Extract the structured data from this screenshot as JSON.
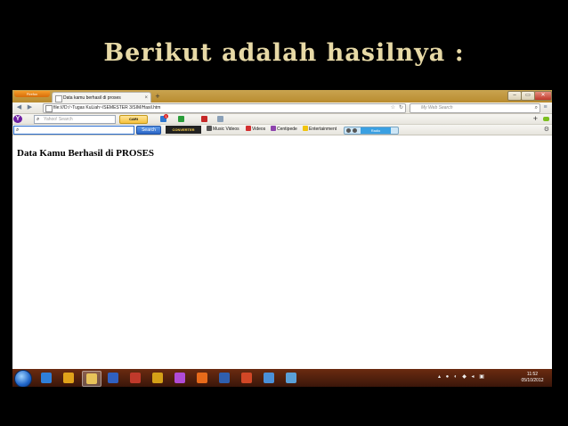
{
  "slide": {
    "title": "Berikut adalah hasilnya :"
  },
  "browser": {
    "menu_button": "Firefox",
    "tab_title": "Data kamu berhasil di proses",
    "tab_close": "×",
    "new_tab": "+",
    "url": "file:///D:/~Tugas KuLiah~/SEMESTER 3/SIM/Hasil.htm",
    "web_search_placeholder": "My Web Search",
    "window_controls": {
      "minimize": "–",
      "maximize": "▭",
      "close": "✕"
    }
  },
  "yahoo_toolbar": {
    "search_placeholder": "Yahoo! Search",
    "button": "CARI",
    "mail_badge": "1"
  },
  "converter_toolbar": {
    "search_button": "Search",
    "converter_label": "CONVERTER",
    "links": [
      "Music Videos",
      "Videos",
      "Centipede",
      "Entertainment"
    ],
    "radio_label": "Radio"
  },
  "page": {
    "heading": "Data Kamu Berhasil di PROSES"
  },
  "taskbar": {
    "time": "11:52",
    "date": "05/10/2012",
    "apps": [
      {
        "name": "ie",
        "color": "#2f7fd9"
      },
      {
        "name": "media",
        "color": "#e0a21a"
      },
      {
        "name": "explorer",
        "color": "#e8c35a",
        "active": true
      },
      {
        "name": "player",
        "color": "#3060c0"
      },
      {
        "name": "tool",
        "color": "#c0392b"
      },
      {
        "name": "paint",
        "color": "#d4a017"
      },
      {
        "name": "c-app",
        "color": "#b04bd6"
      },
      {
        "name": "firefox",
        "color": "#e86a1a"
      },
      {
        "name": "word",
        "color": "#2f5fae"
      },
      {
        "name": "powerpoint",
        "color": "#d24726"
      },
      {
        "name": "window",
        "color": "#4a90d9"
      },
      {
        "name": "explorer2",
        "color": "#5aa0d8"
      }
    ]
  }
}
